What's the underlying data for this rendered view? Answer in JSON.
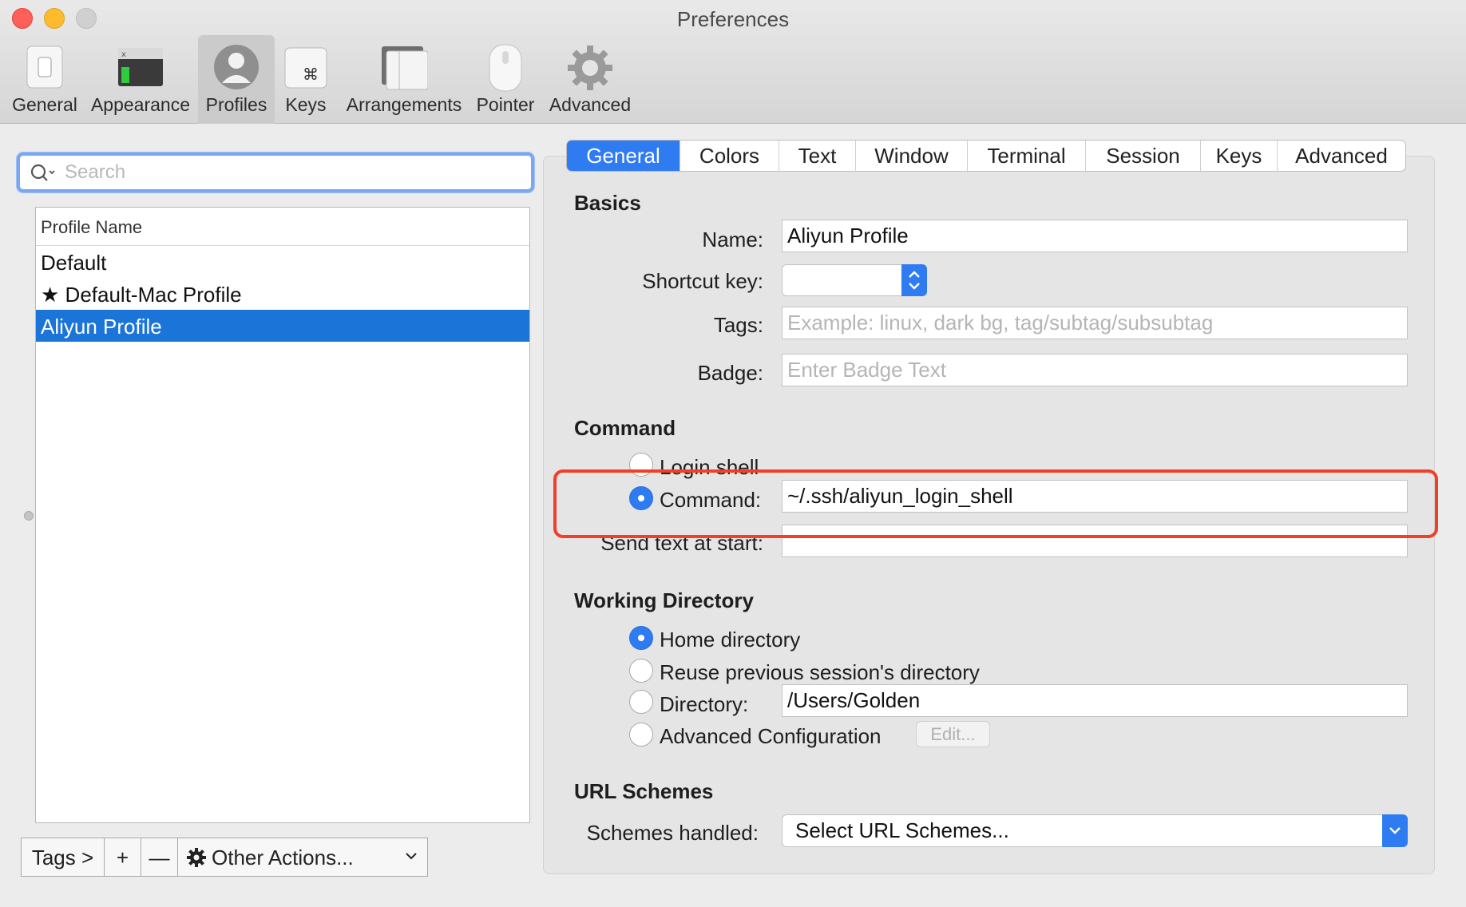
{
  "window": {
    "title": "Preferences"
  },
  "toolbar": {
    "items": [
      {
        "label": "General",
        "icon": "switch-icon"
      },
      {
        "label": "Appearance",
        "icon": "terminal-window-icon"
      },
      {
        "label": "Profiles",
        "icon": "person-icon",
        "selected": true
      },
      {
        "label": "Keys",
        "icon": "command-key-icon"
      },
      {
        "label": "Arrangements",
        "icon": "windows-icon"
      },
      {
        "label": "Pointer",
        "icon": "mouse-icon"
      },
      {
        "label": "Advanced",
        "icon": "gear-icon"
      }
    ]
  },
  "search": {
    "placeholder": "Search",
    "value": ""
  },
  "profiles": {
    "header": "Profile Name",
    "rows": [
      {
        "name": "Default",
        "starred": false,
        "selected": false
      },
      {
        "name": "Default-Mac Profile",
        "starred": true,
        "selected": false
      },
      {
        "name": "Aliyun Profile",
        "starred": false,
        "selected": true
      }
    ],
    "star_glyph": "★"
  },
  "bottom_bar": {
    "tags": "Tags >",
    "add": "+",
    "remove": "—",
    "other_actions": "Other Actions..."
  },
  "tabs": [
    {
      "label": "General",
      "active": true
    },
    {
      "label": "Colors",
      "active": false
    },
    {
      "label": "Text",
      "active": false
    },
    {
      "label": "Window",
      "active": false
    },
    {
      "label": "Terminal",
      "active": false
    },
    {
      "label": "Session",
      "active": false
    },
    {
      "label": "Keys",
      "active": false
    },
    {
      "label": "Advanced",
      "active": false
    }
  ],
  "basics": {
    "title": "Basics",
    "name_label": "Name:",
    "name_value": "Aliyun Profile",
    "shortcut_label": "Shortcut key:",
    "tags_label": "Tags:",
    "tags_placeholder": "Example: linux, dark bg, tag/subtag/subsubtag",
    "badge_label": "Badge:",
    "badge_placeholder": "Enter Badge Text"
  },
  "command": {
    "title": "Command",
    "login_shell_label": "Login shell",
    "command_label": "Command:",
    "command_value": "~/.ssh/aliyun_login_shell",
    "command_selected": true,
    "send_text_label": "Send text at start:",
    "send_text_value": ""
  },
  "working_directory": {
    "title": "Working Directory",
    "home_label": "Home directory",
    "reuse_label": "Reuse previous session's directory",
    "directory_label": "Directory:",
    "directory_value": "/Users/Golden",
    "advanced_label": "Advanced Configuration",
    "edit_label": "Edit...",
    "selected": "home"
  },
  "url_schemes": {
    "title": "URL Schemes",
    "schemes_label": "Schemes handled:",
    "schemes_value": "Select URL Schemes..."
  },
  "colors": {
    "accent": "#2f7bf1",
    "selection": "#1b74d8",
    "highlight": "#f0402a",
    "close": "#fe5f57",
    "minimize": "#febb2e"
  }
}
